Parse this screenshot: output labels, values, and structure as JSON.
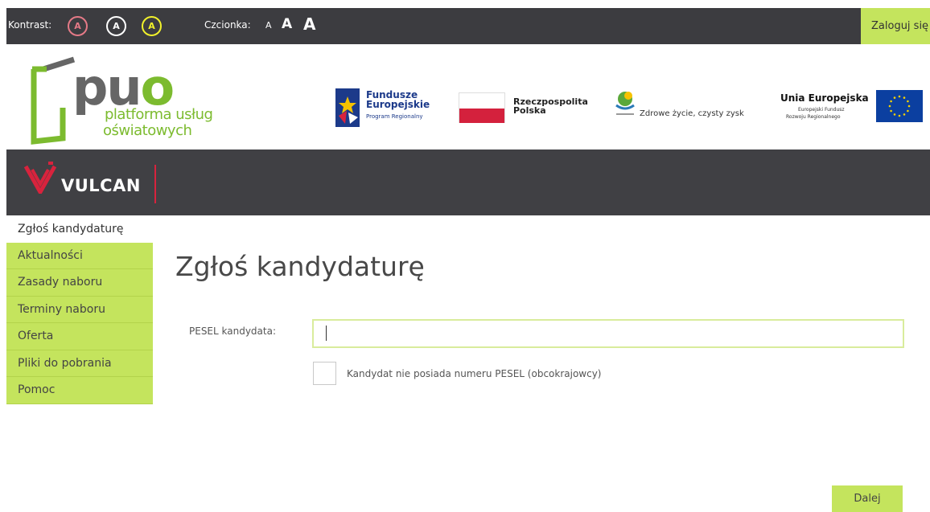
{
  "topbar": {
    "kontrast_label": "Kontrast:",
    "contrast_options": [
      "A",
      "A",
      "A"
    ],
    "contrast_colors": [
      "#e57a87",
      "#ffffff",
      "#f1f12b"
    ],
    "czcionka_label": "Czcionka:",
    "font_sizes": [
      "A",
      "A",
      "A"
    ],
    "login_label": "Zaloguj się"
  },
  "logo": {
    "puo_p": "pu",
    "puo_o": "o",
    "line1": "platforma usług",
    "line2": "oświatowych"
  },
  "partners": {
    "fe_line1": "Fundusze",
    "fe_line2": "Europejskie",
    "fe_line3": "Program Regionalny",
    "rp_line1": "Rzeczpospolita",
    "rp_line2": "Polska",
    "ws_text": "Zdrowe życie, czysty zysk",
    "ue_line1": "Unia Europejska",
    "ue_line2": "Europejski Fundusz",
    "ue_line3": "Rozwoju Regionalnego"
  },
  "vulcan": {
    "name": "VULCAN"
  },
  "sidebar": {
    "items": [
      {
        "label": "Zgłoś kandydaturę",
        "active": true
      },
      {
        "label": "Aktualności"
      },
      {
        "label": "Zasady naboru"
      },
      {
        "label": "Terminy naboru"
      },
      {
        "label": "Oferta"
      },
      {
        "label": "Pliki do pobrania"
      },
      {
        "label": "Pomoc"
      }
    ]
  },
  "main": {
    "title": "Zgłoś kandydaturę",
    "pesel_label": "PESEL kandydata:",
    "pesel_value": "",
    "checkbox_label": "Kandydat nie posiada numeru PESEL (obcokrajowcy)",
    "checkbox_checked": false,
    "next_button": "Dalej"
  },
  "colors": {
    "accent_green": "#c4e45d",
    "dark_bar": "#3c3c40",
    "vulcan_red": "#d8233d"
  }
}
